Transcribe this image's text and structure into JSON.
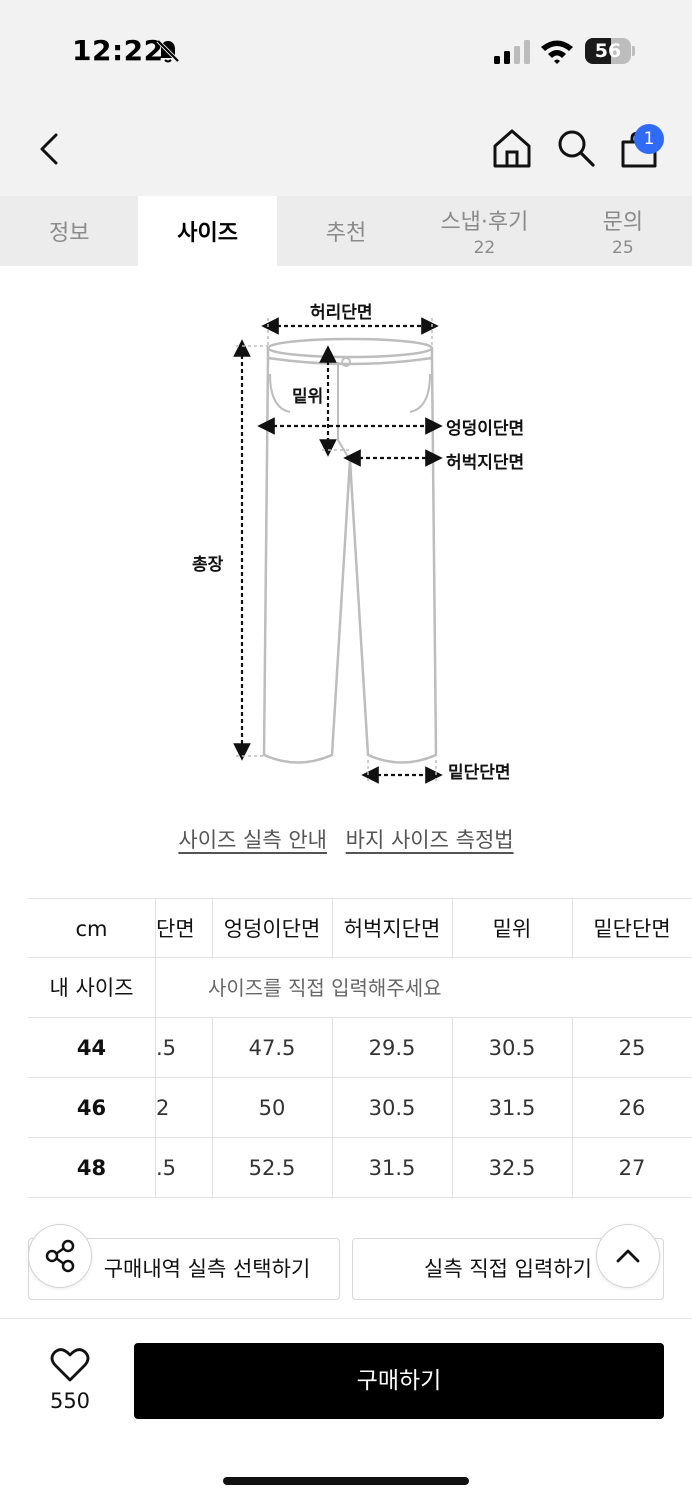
{
  "status_bar": {
    "time": "12:22",
    "battery_percent": "56",
    "battery_level": 0.56
  },
  "nav": {
    "cart_count": "1"
  },
  "tabs": [
    {
      "label": "정보",
      "count": ""
    },
    {
      "label": "사이즈",
      "count": ""
    },
    {
      "label": "추천",
      "count": ""
    },
    {
      "label": "스냅·후기",
      "count": "22"
    },
    {
      "label": "문의",
      "count": "25"
    }
  ],
  "diagram": {
    "waist": "허리단면",
    "rise": "밑위",
    "hip": "엉덩이단면",
    "thigh": "허벅지단면",
    "length": "총장",
    "hem": "밑단단면"
  },
  "guide_links": {
    "size_guide": "사이즈 실측 안내",
    "measure_guide": "바지 사이즈 측정법"
  },
  "size_table": {
    "unit": "cm",
    "columns": [
      "단면",
      "엉덩이단면",
      "허벅지단면",
      "밑위",
      "밑단단면"
    ],
    "my_size_label": "내 사이즈",
    "my_size_placeholder": "사이즈를 직접 입력해주세요",
    "rows": [
      {
        "size": "44",
        "values": [
          ".5",
          "47.5",
          "29.5",
          "30.5",
          "25"
        ]
      },
      {
        "size": "46",
        "values": [
          "2",
          "50",
          "30.5",
          "31.5",
          "26"
        ]
      },
      {
        "size": "48",
        "values": [
          ".5",
          "52.5",
          "31.5",
          "32.5",
          "27"
        ]
      }
    ]
  },
  "actions": {
    "purchase_history": "구매내역 실측 선택하기",
    "direct_input": "실측 직접 입력하기"
  },
  "bottom": {
    "like_count": "550",
    "buy_label": "구매하기"
  },
  "colors": {
    "accent_blue": "#2f6bf5",
    "buy_button": "#000000"
  }
}
